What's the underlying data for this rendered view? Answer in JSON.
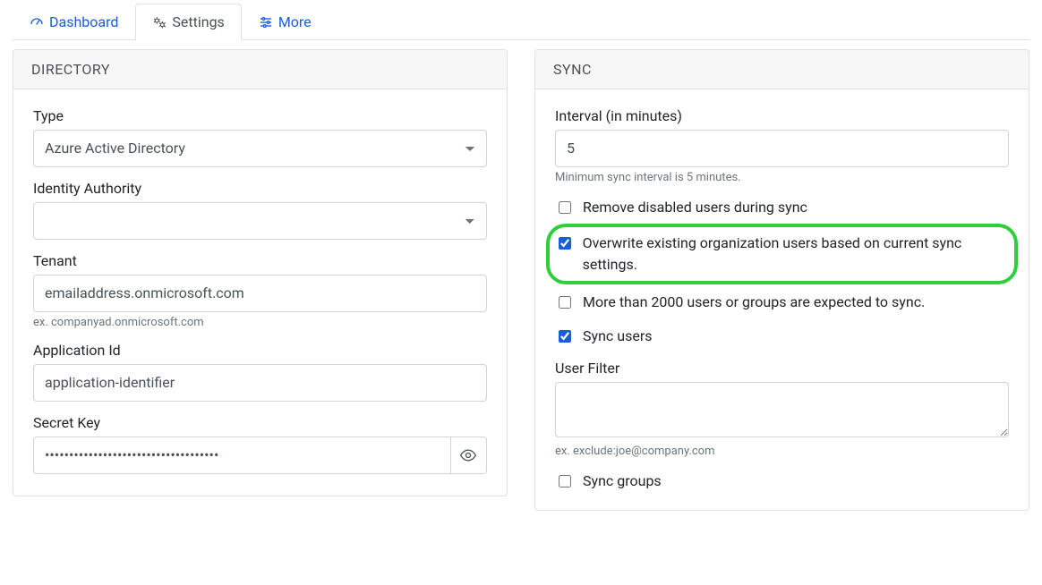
{
  "tabs": {
    "dashboard": "Dashboard",
    "settings": "Settings",
    "more": "More"
  },
  "directory": {
    "header": "DIRECTORY",
    "type_label": "Type",
    "type_value": "Azure Active Directory",
    "identity_label": "Identity Authority",
    "identity_value": "",
    "tenant_label": "Tenant",
    "tenant_value": "emailaddress.onmicrosoft.com",
    "tenant_hint": "ex. companyad.onmicrosoft.com",
    "appid_label": "Application Id",
    "appid_value": "application-identifier",
    "secret_label": "Secret Key",
    "secret_value": "••••••••••••••••••••••••••••••••••••"
  },
  "sync": {
    "header": "SYNC",
    "interval_label": "Interval (in minutes)",
    "interval_value": "5",
    "interval_hint": "Minimum sync interval is 5 minutes.",
    "remove_disabled_label": "Remove disabled users during sync",
    "overwrite_label": "Overwrite existing organization users based on current sync settings.",
    "large_sync_label": "More than 2000 users or groups are expected to sync.",
    "sync_users_label": "Sync users",
    "user_filter_label": "User Filter",
    "user_filter_value": "",
    "user_filter_hint": "ex. exclude:joe@company.com",
    "sync_groups_label": "Sync groups"
  }
}
